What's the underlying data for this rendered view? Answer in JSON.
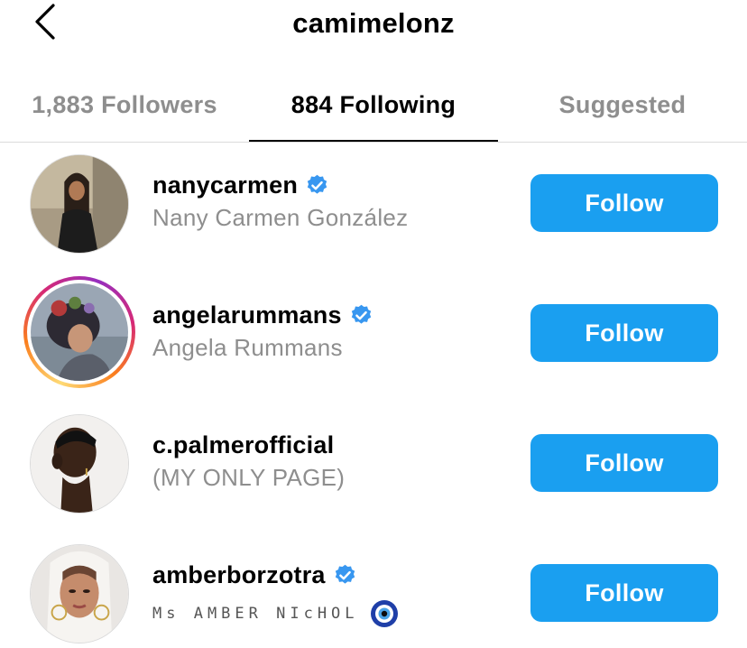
{
  "header": {
    "title": "camimelonz",
    "back_icon": "chevron-left-icon"
  },
  "tabs": [
    {
      "label": "1,883 Followers",
      "active": false
    },
    {
      "label": "884 Following",
      "active": true
    },
    {
      "label": "Suggested",
      "active": false
    }
  ],
  "accounts": [
    {
      "username": "nanycarmen",
      "full_name": "Nany Carmen González",
      "verified": true,
      "story_ring": false,
      "button_label": "Follow"
    },
    {
      "username": "angelarummans",
      "full_name": "Angela Rummans",
      "verified": true,
      "story_ring": true,
      "button_label": "Follow"
    },
    {
      "username": "c.palmerofficial",
      "full_name": "(MY ONLY PAGE)",
      "verified": false,
      "story_ring": false,
      "button_label": "Follow"
    },
    {
      "username": "amberborzotra",
      "full_name": "Ms AMBER NIcHOL",
      "verified": true,
      "story_ring": false,
      "button_label": "Follow",
      "name_emoji": "evil-eye-icon"
    }
  ],
  "colors": {
    "accent": "#1a9ff0",
    "verified": "#3897f0",
    "secondary_text": "#8e8e8e"
  }
}
